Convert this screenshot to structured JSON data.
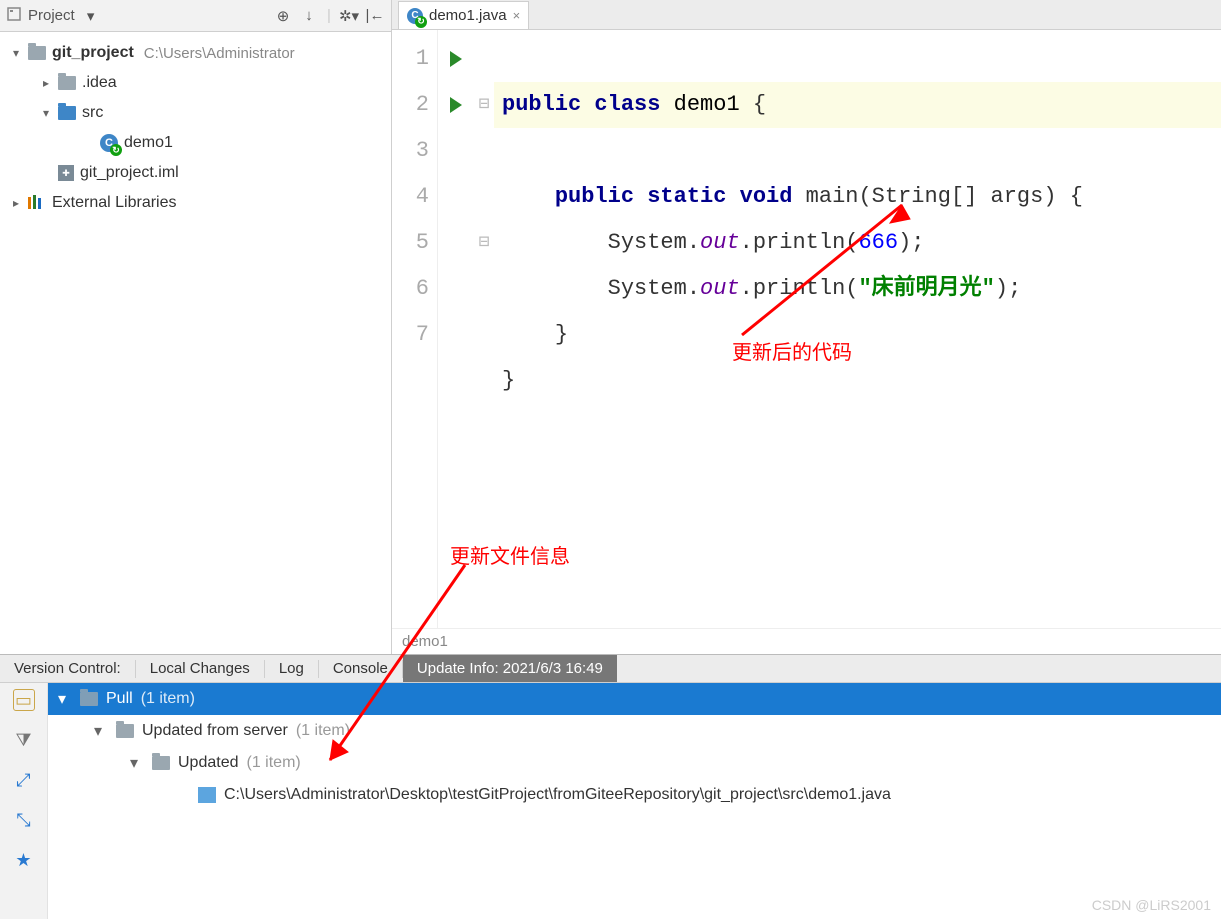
{
  "project_panel": {
    "title": "Project",
    "toolbar_icons": [
      "target-icon",
      "refresh-icon",
      "divider",
      "gear-icon",
      "collapse-icon"
    ],
    "tree": [
      {
        "level": 0,
        "tw": "▾",
        "icon": "folder-gray",
        "label": "git_project",
        "bold": true,
        "path": "C:\\Users\\Administrator"
      },
      {
        "level": 1,
        "tw": "▸",
        "icon": "folder-gray",
        "label": ".idea"
      },
      {
        "level": 1,
        "tw": "▾",
        "icon": "folder-blue",
        "label": "src"
      },
      {
        "level": 2,
        "tw": "",
        "icon": "class",
        "label": "demo1"
      },
      {
        "level": 1,
        "tw": "",
        "icon": "iml",
        "label": "git_project.iml"
      },
      {
        "level": 0,
        "tw": "▸",
        "icon": "libs",
        "label": "External Libraries",
        "topindent": true
      }
    ]
  },
  "editor": {
    "tab_label": "demo1.java",
    "lines": [
      "1",
      "2",
      "3",
      "4",
      "5",
      "6",
      "7"
    ],
    "run_rows": [
      0,
      1
    ],
    "fold_rows_open": [
      1
    ],
    "fold_rows_close": [
      4
    ],
    "code": {
      "kw_public": "public",
      "kw_class": "class",
      "classname": "demo1",
      "brace_open": "{",
      "kw_static": "static",
      "kw_void": "void",
      "main": "main",
      "args": "(String[] args)",
      "sys": "System.",
      "out": "out",
      "println": ".println(",
      "num": "666",
      "close_paren": ");",
      "str": "\"床前明月光\"",
      "brace1": "}",
      "brace2": "}"
    },
    "annot_code": "更新后的代码",
    "breadcrumb": "demo1"
  },
  "vc": {
    "header_label": "Version Control:",
    "tabs": [
      "Local Changes",
      "Log",
      "Console"
    ],
    "active_tab": "Update Info: 2021/6/3 16:49",
    "annot_panel": "更新文件信息",
    "side_icons": [
      "group-icon",
      "filter-icon",
      "expand-icon",
      "collapse-icon",
      "import-icon"
    ],
    "rows": [
      {
        "level": 0,
        "sel": true,
        "label": "Pull",
        "count": "(1 item)"
      },
      {
        "level": 1,
        "label": "Updated from server",
        "count": "(1 item)"
      },
      {
        "level": 2,
        "label": "Updated",
        "count": "(1 item)"
      },
      {
        "level": 3,
        "file": true,
        "label": "C:\\Users\\Administrator\\Desktop\\testGitProject\\fromGiteeRepository\\git_project\\src\\demo1.java"
      }
    ]
  },
  "watermark": "CSDN @LiRS2001"
}
